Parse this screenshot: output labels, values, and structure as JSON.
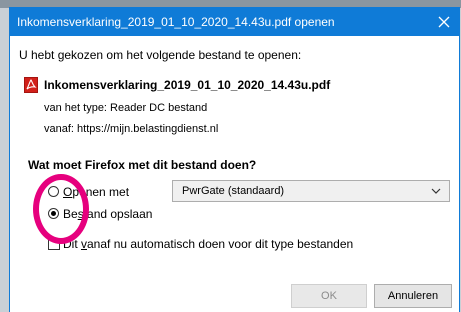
{
  "dialog": {
    "title": "Inkomensverklaring_2019_01_10_2020_14.43u.pdf openen",
    "intro": "U hebt gekozen om het volgende bestand te openen:",
    "file": {
      "name": "Inkomensverklaring_2019_01_10_2020_14.43u.pdf",
      "icon": "pdf-icon",
      "type_line": "van het type:  Reader DC bestand",
      "from_line": "vanaf:  https://mijn.belastingdienst.nl"
    },
    "question": "Wat moet Firefox met dit bestand doen?",
    "options": {
      "open_prefix": "",
      "open_accel": "O",
      "open_rest": "penen met",
      "app_select_value": "PwrGate (standaard)",
      "save_prefix": "Be",
      "save_accel": "s",
      "save_rest": "tand opslaan",
      "selected": "save"
    },
    "auto": {
      "prefix": "Dit ",
      "accel": "v",
      "rest": "anaf nu automatisch doen voor dit type bestanden",
      "checked": false
    },
    "buttons": {
      "ok": "OK",
      "cancel": "Annuleren"
    }
  },
  "colors": {
    "titlebar": "#0f7bd7",
    "highlight_ring": "#e6007e",
    "pdf_icon": "#d2201a"
  }
}
